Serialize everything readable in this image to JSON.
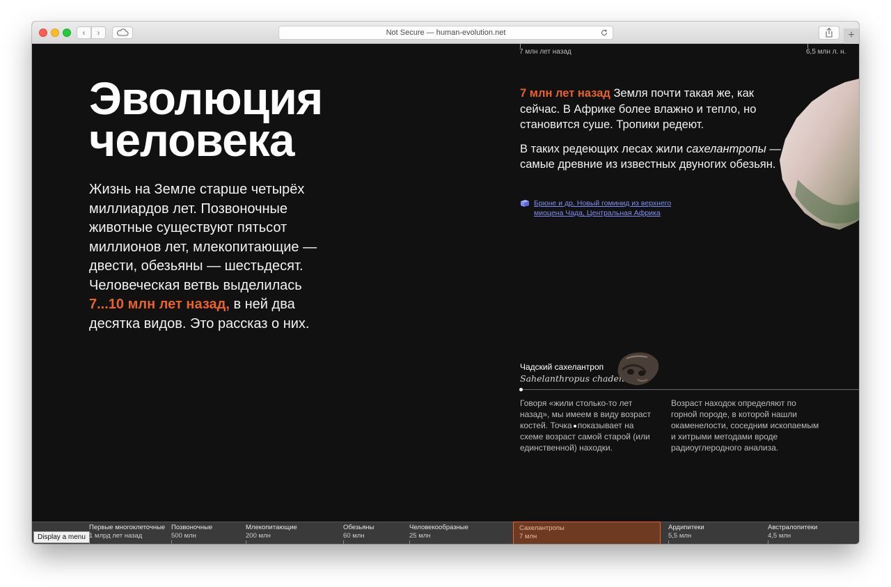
{
  "browser": {
    "address_text": "Not Secure — human-evolution.net",
    "plus_label": "+"
  },
  "ruler": {
    "left_label": "7 млн лет назад",
    "right_label": "6,5 млн л. н."
  },
  "hero": {
    "title_line1": "Эволюция",
    "title_line2": "человека",
    "intro_part1": "Жизнь на Земле старше четырёх миллиардов лет. Позвоночные животные существуют пятьсот миллионов лет, млекопитающие — двести, обезьяны — шестьдесят. Человеческая ветвь выделилась ",
    "intro_accent": "7...10 млн лет назад,",
    "intro_part2": " в ней два десятка видов. Это рассказ о них."
  },
  "era": {
    "p1_accent": "7 млн лет назад",
    "p1_text": " Земля почти такая же, как сейчас. В Африке более влажно и тепло, но становится суше. Тропики редеют.",
    "p2_text1": "В таких редеющих лесах жили ",
    "p2_italic": "сахелантропы",
    "p2_text2": " — самые древние из известных двуногих обезьян.",
    "reference": "Брюне и др. Новый гоминид из верхнего миоцена Чада, Центральная Африка"
  },
  "species": {
    "name": "Чадский сахелантроп",
    "latin": "Sahelanthropus chadensis"
  },
  "notes": {
    "note1_part1": "Говоря «жили столько-то лет назад», мы имеем в виду возраст костей. Точка",
    "note1_part2": "показывает на схеме возраст самой старой (или единственной) находки.",
    "note2": "Возраст находок определяют по горной породе, в которой нашли окаменелости, соседним ископаемым и хитрыми методами вроде радиоуглеродного анализа."
  },
  "timeline": {
    "items": [
      {
        "name": "Первые многоклеточные",
        "date": "1 млрд лет назад"
      },
      {
        "name": "Позвоночные",
        "date": "500 млн"
      },
      {
        "name": "Млекопитающие",
        "date": "200 млн"
      },
      {
        "name": "Обезьяны",
        "date": "60 млн"
      },
      {
        "name": "Человекообразные",
        "date": "25 млн"
      },
      {
        "name": "Сахелантропы",
        "date": "7 млн"
      },
      {
        "name": "Ардипитеки",
        "date": "5,5 млн"
      },
      {
        "name": "Австралопитеки",
        "date": "4,5 млн"
      }
    ],
    "menu_tooltip": "Display a menu"
  },
  "colors": {
    "accent": "#e8622a",
    "link": "#7f8ef2",
    "background": "#111111"
  }
}
